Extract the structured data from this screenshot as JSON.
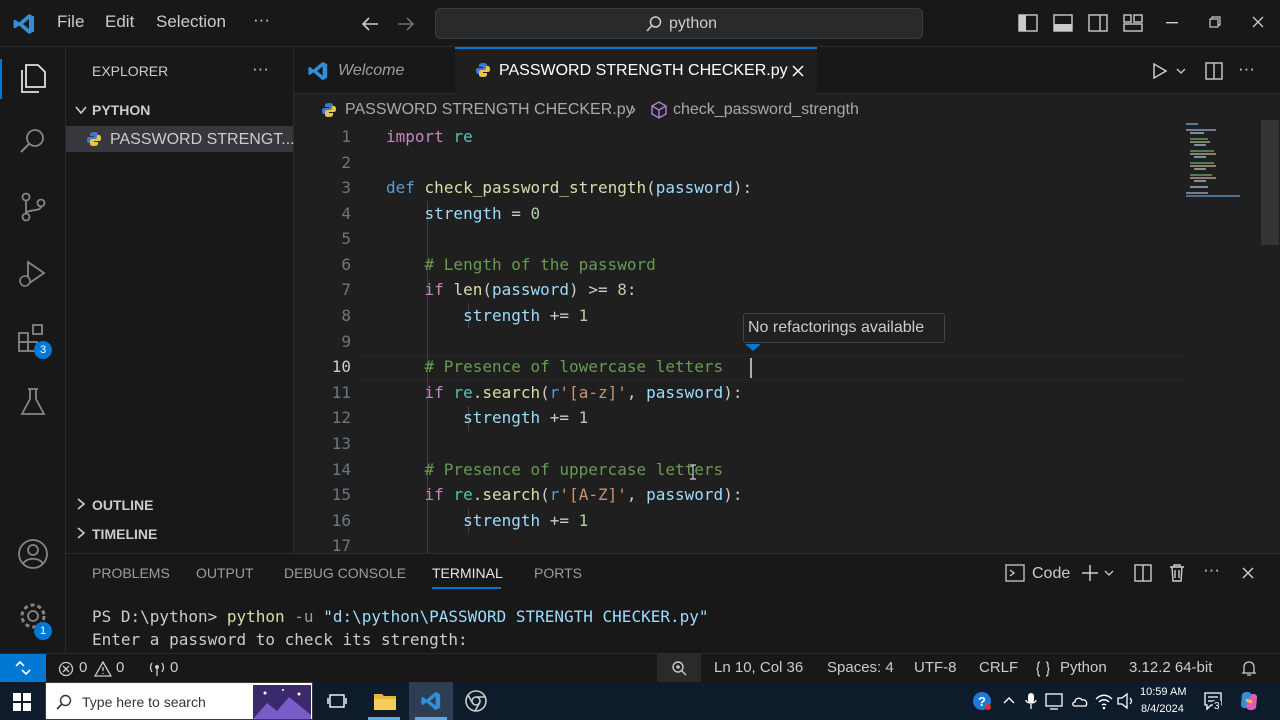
{
  "titlebar": {
    "menu": [
      "File",
      "Edit",
      "Selection",
      "···"
    ],
    "search": "python"
  },
  "activity": {
    "extensions_badge": "3",
    "settings_badge": "1"
  },
  "sidebar": {
    "explorer_label": "EXPLORER",
    "folder_label": "PYTHON",
    "file_label": "PASSWORD STRENGT...",
    "outline_label": "OUTLINE",
    "timeline_label": "TIMELINE"
  },
  "tabs": {
    "welcome": "Welcome",
    "active": "PASSWORD STRENGTH CHECKER.py"
  },
  "breadcrumb": {
    "file": "PASSWORD STRENGTH CHECKER.py",
    "separator": "›",
    "symbol": "check_password_strength"
  },
  "editor": {
    "line_numbers": [
      "1",
      "2",
      "3",
      "4",
      "5",
      "6",
      "7",
      "8",
      "9",
      "10",
      "11",
      "12",
      "13",
      "14",
      "15",
      "16",
      "17"
    ],
    "tooltip": "No refactorings available",
    "lines": [
      "import re",
      "",
      "def check_password_strength(password):",
      "    strength = 0",
      "",
      "    # Length of the password",
      "    if len(password) >= 8:",
      "        strength += 1",
      "",
      "    # Presence of lowercase letters",
      "    if re.search(r'[a-z]', password):",
      "        strength += 1",
      "",
      "    # Presence of uppercase letters",
      "    if re.search(r'[A-Z]', password):",
      "        strength += 1"
    ]
  },
  "panel": {
    "tabs": [
      "PROBLEMS",
      "OUTPUT",
      "DEBUG CONSOLE",
      "TERMINAL",
      "PORTS"
    ],
    "active_tab": "TERMINAL",
    "shell_label": "Code",
    "terminal": {
      "prompt": "PS D:\\python> ",
      "command": "python",
      "flag": " -u ",
      "arg": "\"d:\\python\\PASSWORD STRENGTH CHECKER.py\"",
      "output": "Enter a password to check its strength:"
    }
  },
  "statusbar": {
    "errors": "0",
    "warnings": "0",
    "ports": "0",
    "position": "Ln 10, Col 36",
    "spaces": "Spaces: 4",
    "encoding": "UTF-8",
    "eol": "CRLF",
    "language": "Python",
    "interpreter": "3.12.2 64-bit"
  },
  "taskbar": {
    "search_placeholder": "Type here to search",
    "time": "10:59 AM",
    "date": "8/4/2024",
    "notifications": "3"
  },
  "colors": {
    "accent": "#0078d4",
    "keyword": "#569cd6",
    "function": "#dcdcaa",
    "variable": "#9cdcfe",
    "string": "#ce9178",
    "comment": "#6a9955",
    "number": "#b5cea8"
  }
}
